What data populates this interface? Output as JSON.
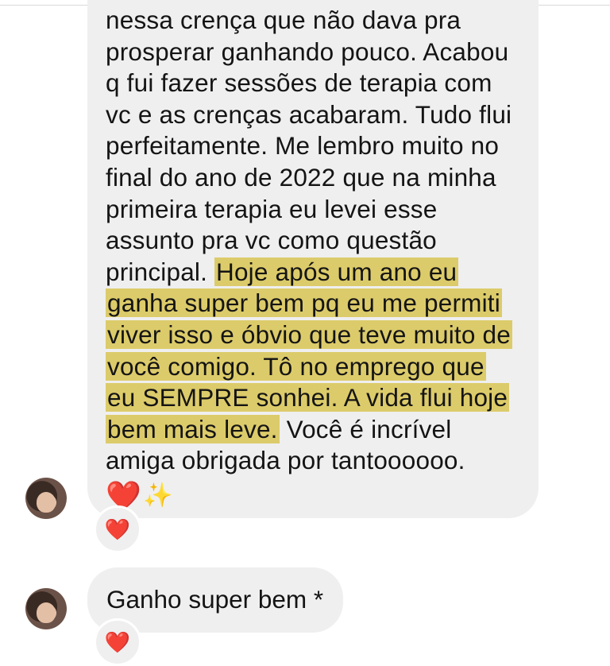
{
  "messages": [
    {
      "sender": "contact",
      "lines": [
        {
          "plain": "nessa crença que não dava pra"
        },
        {
          "plain": "prosperar ganhando pouco. Acabou"
        },
        {
          "plain": "q fui fazer sessões de terapia com"
        },
        {
          "plain": "vc e as crenças acabaram. Tudo flui"
        },
        {
          "plain": "perfeitamente. Me lembro muito no"
        },
        {
          "plain": "final do ano de 2022 que na minha"
        },
        {
          "plain": "primeira terapia eu levei esse"
        },
        {
          "plain": "assunto pra vc como questão"
        },
        {
          "plain": "principal. ",
          "highlight": "Hoje após um ano eu"
        },
        {
          "highlight": "ganha super bem pq eu me permiti"
        },
        {
          "highlight": "viver isso e óbvio que teve muito de"
        },
        {
          "highlight": "você comigo. Tô no emprego que"
        },
        {
          "highlight": "eu SEMPRE sonhei. A vida flui hoje"
        },
        {
          "highlight": "bem mais leve.",
          "plain_after": " Você é incrível"
        },
        {
          "plain": "amiga obrigada por tantoooooo."
        }
      ],
      "emojis": [
        "❤️",
        "✨"
      ],
      "reaction": "❤️"
    },
    {
      "sender": "contact",
      "text": "Ganho super bem *",
      "reaction": "❤️"
    }
  ],
  "colors": {
    "bubble": "#efefef",
    "highlight": "#dccb6a",
    "heart": "#e0182d"
  },
  "icons": {
    "avatar": "profile-photo",
    "reaction": "heart-icon",
    "sparkles": "sparkles-icon"
  }
}
